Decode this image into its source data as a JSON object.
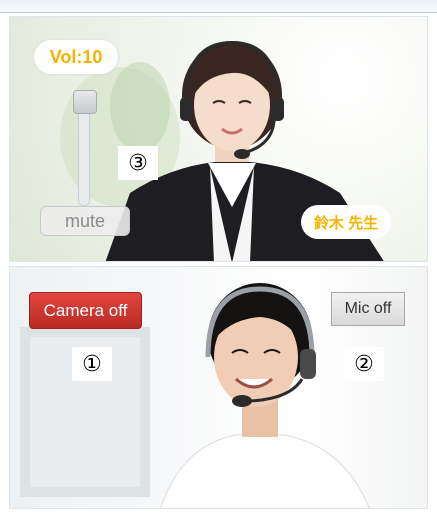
{
  "teacher_video": {
    "volume_label": "Vol:10",
    "volume_level": 10,
    "mute_label": "mute",
    "name_label": "鈴木 先生",
    "marker": "③"
  },
  "student_video": {
    "camera_off_label": "Camera off",
    "mic_off_label": "Mic off",
    "camera_marker": "①",
    "mic_marker": "②"
  },
  "colors": {
    "accent_yellow": "#f3b400",
    "camera_button_red": "#cc3530"
  },
  "icons": [
    "headset-icon"
  ]
}
